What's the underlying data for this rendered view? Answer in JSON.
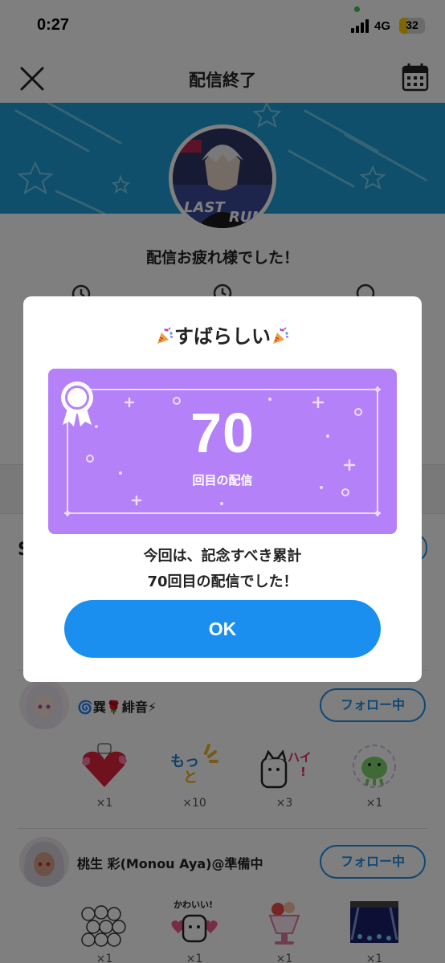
{
  "status_bar": {
    "time": "0:27",
    "network": "4G",
    "battery": "32"
  },
  "header": {
    "title": "配信終了"
  },
  "summary": {
    "message": "配信お疲れ様でした！",
    "section_initial": "S"
  },
  "users": [
    {
      "name": "🌀巽🌹緋音⚡",
      "follow_label": "フォロー中",
      "gifts": [
        {
          "icon": "heart-cat-stamp",
          "count": "×1"
        },
        {
          "icon": "motto-stamp",
          "count": "×10"
        },
        {
          "icon": "hai-cat-stamp",
          "count": "×3"
        },
        {
          "icon": "green-mascot-stamp",
          "count": "×1"
        }
      ]
    },
    {
      "name": "桃生 彩(Monou Aya)@準備中",
      "follow_label": "フォロー中",
      "gifts": [
        {
          "icon": "cat-crowd-stamp",
          "count": "×1"
        },
        {
          "icon": "kawaii-cat-stamp",
          "count": "×1"
        },
        {
          "icon": "parfait-stamp",
          "count": "×1"
        },
        {
          "icon": "stage-stamp",
          "count": "×1"
        }
      ]
    }
  ],
  "modal": {
    "title": "すばらしい",
    "count": "70",
    "count_label": "回目の配信",
    "message_line1": "今回は、記念すべき累計",
    "message_line2": "70回目の配信でした！",
    "ok_label": "OK"
  },
  "colors": {
    "accent": "#1a8ff0",
    "certificate": "#b581f8",
    "banner": "#1e9fd8"
  }
}
